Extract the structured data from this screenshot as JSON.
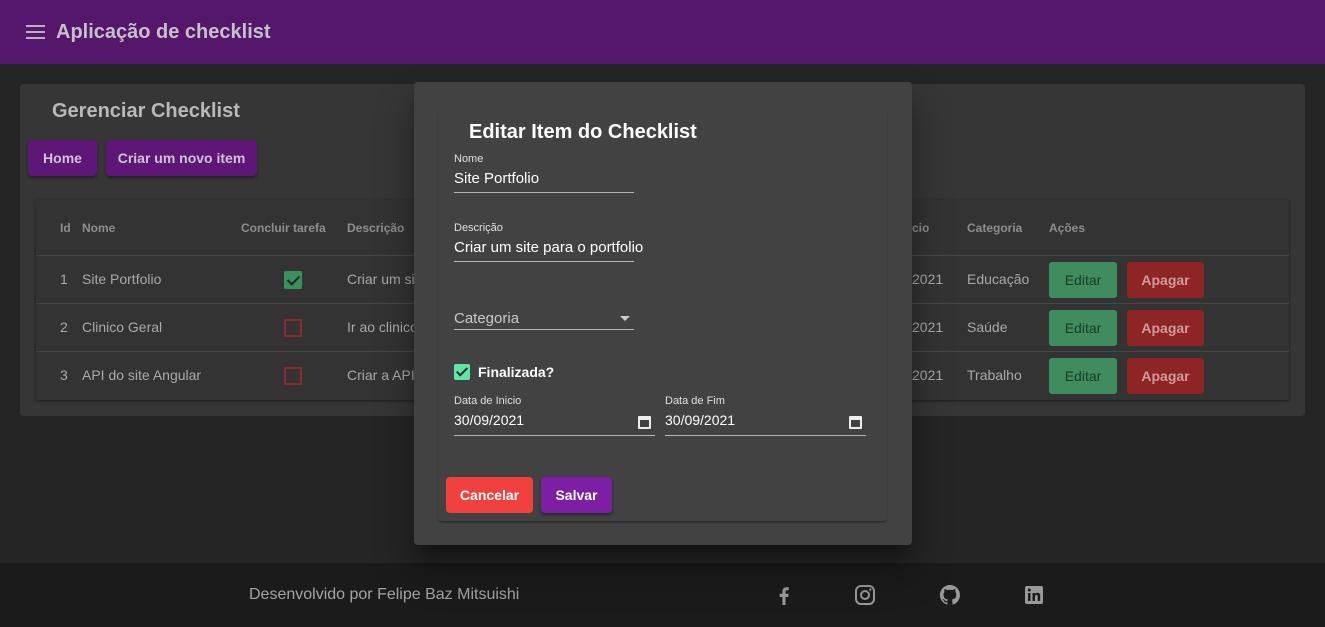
{
  "toolbar": {
    "title": "Aplicação de checklist",
    "menu_icon": "menu-icon"
  },
  "page": {
    "title": "Gerenciar Checklist",
    "buttons": {
      "home": "Home",
      "new_item": "Criar um novo item"
    },
    "table": {
      "headers": [
        "Id",
        "Nome",
        "Concluir tarefa",
        "Descrição",
        "cio",
        "Categoria",
        "Ações"
      ],
      "rows": [
        {
          "id": "1",
          "name": "Site Portfolio",
          "done": true,
          "description": "Criar um si",
          "date": "2021",
          "category": "Educação",
          "edit": "Editar",
          "delete": "Apagar"
        },
        {
          "id": "2",
          "name": "Clinico Geral",
          "done": false,
          "description": "Ir ao clinico",
          "date": "2021",
          "category": "Saúde",
          "edit": "Editar",
          "delete": "Apagar"
        },
        {
          "id": "3",
          "name": "API do site Angular",
          "done": false,
          "description": "Criar a API",
          "date": "2021",
          "category": "Trabalho",
          "edit": "Editar",
          "delete": "Apagar"
        }
      ]
    }
  },
  "dialog": {
    "title": "Editar Item do Checklist",
    "name_label": "Nome",
    "name_value": "Site Portfolio",
    "description_label": "Descrição",
    "description_value": "Criar um site para o portfolio",
    "category_placeholder": "Categoria",
    "finished_label": "Finalizada?",
    "finished": true,
    "start_label": "Data de Inicio",
    "start_value": "30/09/2021",
    "end_label": "Data de Fim",
    "end_value": "30/09/2021",
    "cancel": "Cancelar",
    "save": "Salvar"
  },
  "footer": {
    "text": "Desenvolvido por Felipe Baz Mitsuishi",
    "icons": [
      "facebook-icon",
      "instagram-icon",
      "github-icon",
      "linkedin-icon"
    ]
  },
  "colors": {
    "toolbar": "#54176a",
    "primary": "#7c1fa4",
    "warn": "#f0413f",
    "success": "#3f8c5e",
    "danger": "#8d2525"
  }
}
